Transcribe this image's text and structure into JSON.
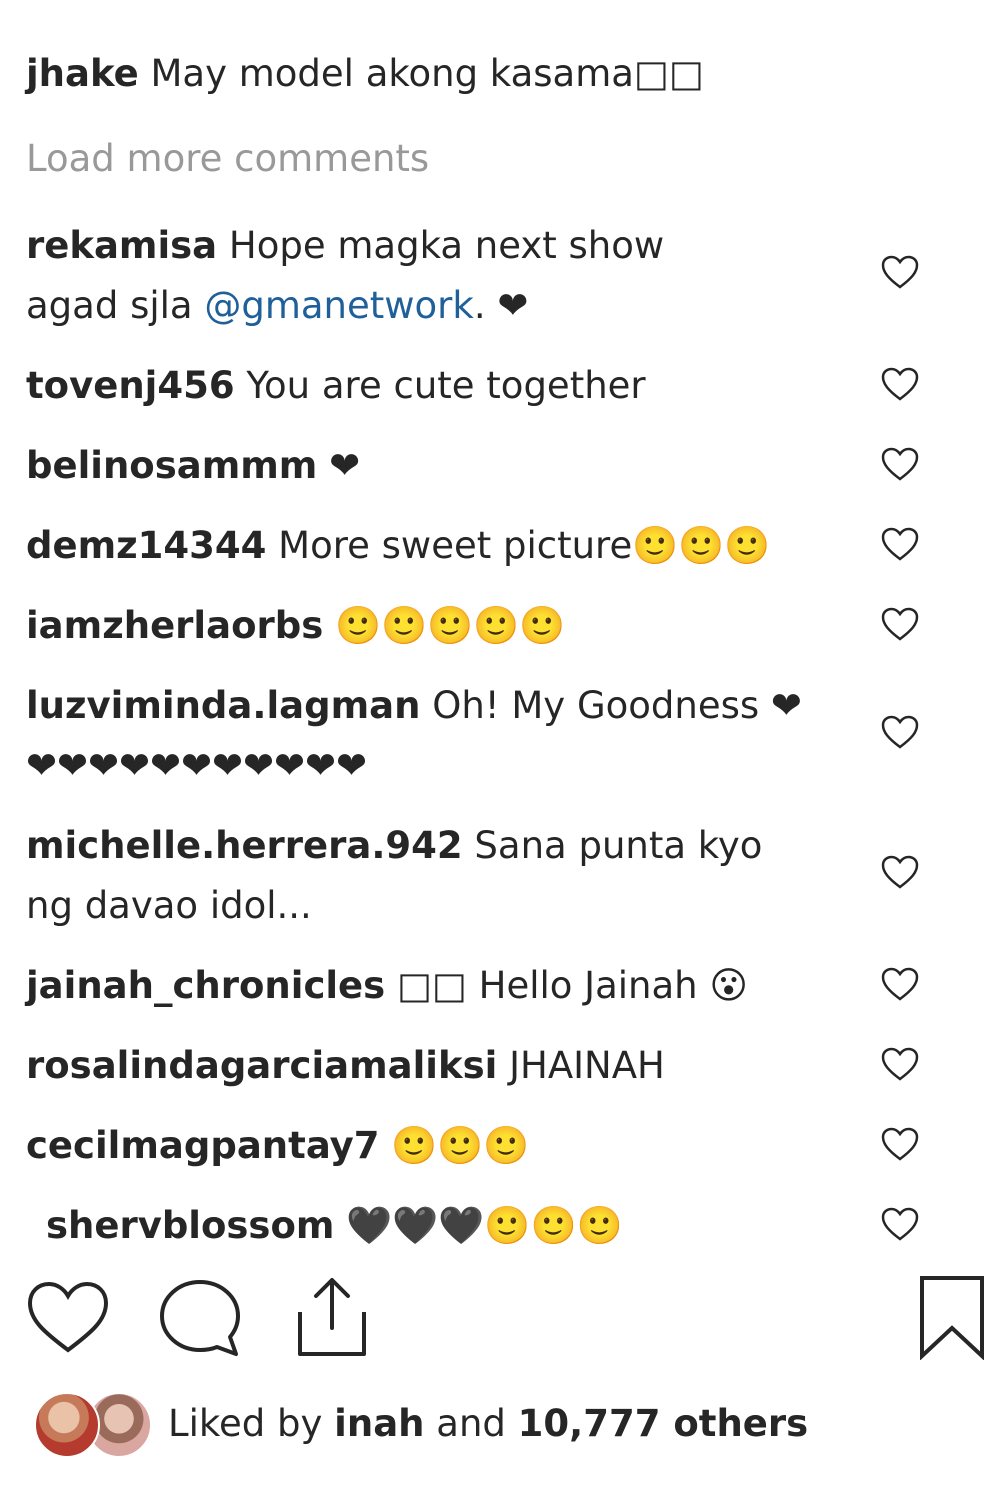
{
  "caption": {
    "username": "jhake",
    "text": "May model akong kasama□□"
  },
  "load_more_label": "Load more comments",
  "comments": [
    {
      "username": "rekamisa",
      "text": "Hope magka next show agad sjla",
      "mention": "@gmanetwork",
      "after": ". ❤"
    },
    {
      "username": "tovenj456",
      "text": "You are cute together"
    },
    {
      "username": "belinosammm",
      "text": "❤"
    },
    {
      "username": "demz14344",
      "text": "More sweet picture🙂🙂🙂"
    },
    {
      "username": "iamzherlaorbs",
      "text": "🙂🙂🙂🙂🙂"
    },
    {
      "username": "luzviminda.lagman",
      "text": "Oh! My Goodness ❤❤❤❤❤❤❤❤❤❤❤❤"
    },
    {
      "username": "michelle.herrera.942",
      "text": "Sana punta kyo ng davao idol..."
    },
    {
      "username": "jainah_chronicles",
      "text": "□□ Hello Jainah 😮"
    },
    {
      "username": "rosalindagarciamaliksi",
      "text": "JHAINAH"
    },
    {
      "username": "cecilmagpantay7",
      "text": "🙂🙂🙂"
    },
    {
      "username": "shervblossom",
      "text": "🖤🖤🖤🙂🙂🙂"
    }
  ],
  "actions": {
    "like_icon": "heart-outline-icon",
    "comment_icon": "speech-bubble-icon",
    "share_icon": "share-upload-icon",
    "save_icon": "bookmark-icon"
  },
  "likes": {
    "prefix": "Liked by",
    "user": "inah",
    "middle": "and",
    "count_text": "10,777 others"
  },
  "colors": {
    "text": "#262626",
    "muted": "#999999",
    "link": "#1f5f9a",
    "icon": "#262626"
  }
}
